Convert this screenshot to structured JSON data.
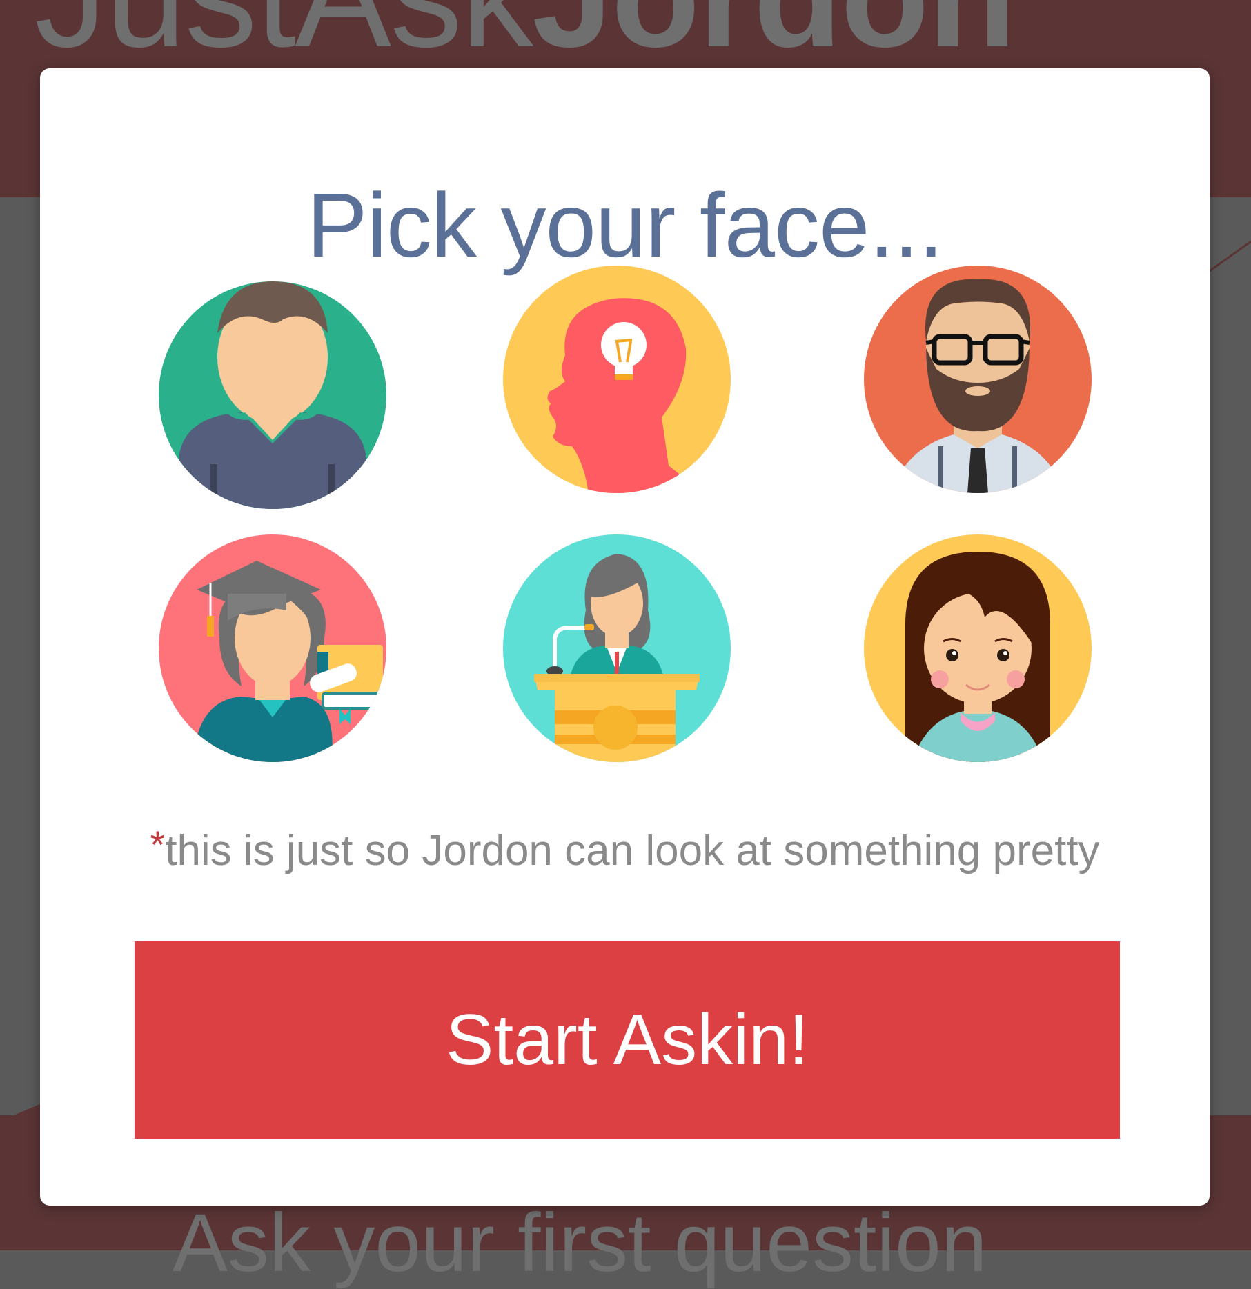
{
  "background": {
    "logo_light": "Just",
    "logo_mid": "Ask",
    "logo_bold": "Jordon",
    "footer_text": "Ask your first question"
  },
  "modal": {
    "title": "Pick your face...",
    "avatars": [
      {
        "name": "woman-avatar",
        "bg_color": "#2bb08c"
      },
      {
        "name": "idea-head-avatar",
        "bg_color": "#fec955"
      },
      {
        "name": "bearded-man-avatar",
        "bg_color": "#eb6d4b"
      },
      {
        "name": "graduate-avatar",
        "bg_color": "#fe7379"
      },
      {
        "name": "speaker-avatar",
        "bg_color": "#5ddfd6"
      },
      {
        "name": "girl-avatar",
        "bg_color": "#fec955"
      }
    ],
    "note_asterisk": "*",
    "note_text": "this is just so Jordon can look at something pretty",
    "start_button_label": "Start Askin!"
  },
  "colors": {
    "title": "#5a7096",
    "button": "#dd4043",
    "backdrop_header": "#5b3536",
    "backdrop": "#5a5a5a"
  }
}
